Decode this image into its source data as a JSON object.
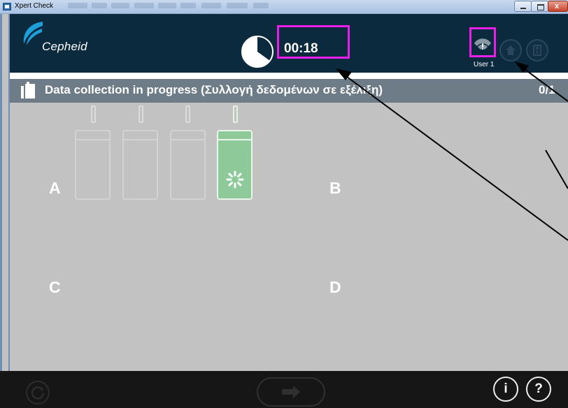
{
  "window": {
    "title": "Xpert Check"
  },
  "header": {
    "logo_text": "Cepheid",
    "timer": "00:18",
    "timer_progress": 0.35,
    "user_label": "User 1",
    "user_icon": "user-warning-icon"
  },
  "status": {
    "text": "Data collection in progress (Συλλογή δεδομένων σε εξέλιξη)",
    "count": "0/1"
  },
  "modules": {
    "a": "A",
    "b": "B",
    "c": "C",
    "d": "D",
    "a_active_bay": 4,
    "a_bay_count": 4
  },
  "footer": {
    "info_label": "i",
    "help_label": "?",
    "next_icon": "arrow-right-icon",
    "refresh_icon": "refresh-icon"
  },
  "colors": {
    "header_bg": "#0c2a3e",
    "status_bg": "#6e7c87",
    "main_bg": "#c2c2c2",
    "footer_bg": "#161616",
    "active_module": "#8ec99a",
    "highlight": "#ea1ee6",
    "logo_blue": "#1d9fd9"
  }
}
